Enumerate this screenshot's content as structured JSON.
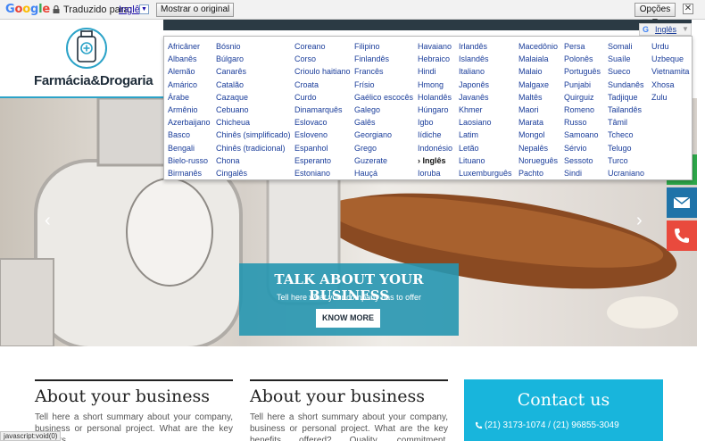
{
  "translate_bar": {
    "logo_letters": [
      {
        "char": "G",
        "color": "#4285f4"
      },
      {
        "char": "o",
        "color": "#ea4335"
      },
      {
        "char": "o",
        "color": "#fbbc05"
      },
      {
        "char": "g",
        "color": "#4285f4"
      },
      {
        "char": "l",
        "color": "#34a853"
      },
      {
        "char": "e",
        "color": "#ea4335"
      }
    ],
    "translated_to_label": "Traduzido para:",
    "target_language": "Inglês",
    "show_original_label": "Mostrar o original",
    "options_label": "Opções ▼",
    "close_label": "✕"
  },
  "header": {
    "logo_text": "Farmácia&Drogaria",
    "accent_color": "#2ca3c8"
  },
  "language_menu": {
    "header_label": "Inglês",
    "selected": "Inglês",
    "columns": [
      [
        "Africâner",
        "Albanês",
        "Alemão",
        "Amárico",
        "Árabe",
        "Armênio",
        "Azerbaijano",
        "Basco",
        "Bengali",
        "Bielo-russo",
        "Birmanês"
      ],
      [
        "Bósnio",
        "Búlgaro",
        "Canarês",
        "Catalão",
        "Cazaque",
        "Cebuano",
        "Chicheua",
        "Chinês (simplificado)",
        "Chinês (tradicional)",
        "Chona",
        "Cingalês"
      ],
      [
        "Coreano",
        "Corso",
        "Crioulo haitiano",
        "Croata",
        "Curdo",
        "Dinamarquês",
        "Eslovaco",
        "Esloveno",
        "Espanhol",
        "Esperanto",
        "Estoniano"
      ],
      [
        "Filipino",
        "Finlandês",
        "Francês",
        "Frísio",
        "Gaélico escocês",
        "Galego",
        "Galês",
        "Georgiano",
        "Grego",
        "Guzerate",
        "Hauçá"
      ],
      [
        "Havaiano",
        "Hebraico",
        "Hindi",
        "Hmong",
        "Holandês",
        "Húngaro",
        "Igbo",
        "Iídiche",
        "Indonésio",
        "› Inglês",
        "Ioruba"
      ],
      [
        "Irlandês",
        "Islandês",
        "Italiano",
        "Japonês",
        "Javanês",
        "Khmer",
        "Laosiano",
        "Latim",
        "Letão",
        "Lituano",
        "Luxemburguês"
      ],
      [
        "Macedônio",
        "Malaiala",
        "Malaio",
        "Malgaxe",
        "Maltês",
        "Maori",
        "Marata",
        "Mongol",
        "Nepalês",
        "Norueguês",
        "Pachto"
      ],
      [
        "Persa",
        "Polonês",
        "Português",
        "Punjabi",
        "Quirguiz",
        "Romeno",
        "Russo",
        "Samoano",
        "Sérvio",
        "Sessoto",
        "Sindi"
      ],
      [
        "Somali",
        "Suaíle",
        "Sueco",
        "Sundanês",
        "Tadjique",
        "Tailandês",
        "Tâmil",
        "Tcheco",
        "Telugo",
        "Turco",
        "Ucraniano"
      ],
      [
        "Urdu",
        "Uzbeque",
        "Vietnamita",
        "Xhosa",
        "Zulu"
      ]
    ]
  },
  "hero": {
    "title": "TALK ABOUT YOUR BUSINESS",
    "subtitle": "Tell here what your company has to offer",
    "button_label": "KNOW MORE",
    "prev_arrow": "‹",
    "next_arrow": "›"
  },
  "floating_buttons": {
    "whatsapp_icon": "whatsapp-icon",
    "mail_icon": "mail-icon",
    "phone_icon": "phone-icon"
  },
  "content": {
    "col1": {
      "title": "About your business",
      "text": "Tell here a short summary about your company, business or personal project. What are the key benefits"
    },
    "col2": {
      "title": "About your business",
      "text": "Tell here a short summary about your company, business or personal project. What are the key benefits offered? Quality, commitment, competitive price. Add"
    },
    "contact": {
      "title": "Contact us",
      "phone": "(21) 3173-1074 / (21) 96855-3049",
      "color": "#18b5dc"
    }
  },
  "status_bar": {
    "text": "javascript:void(0)"
  }
}
